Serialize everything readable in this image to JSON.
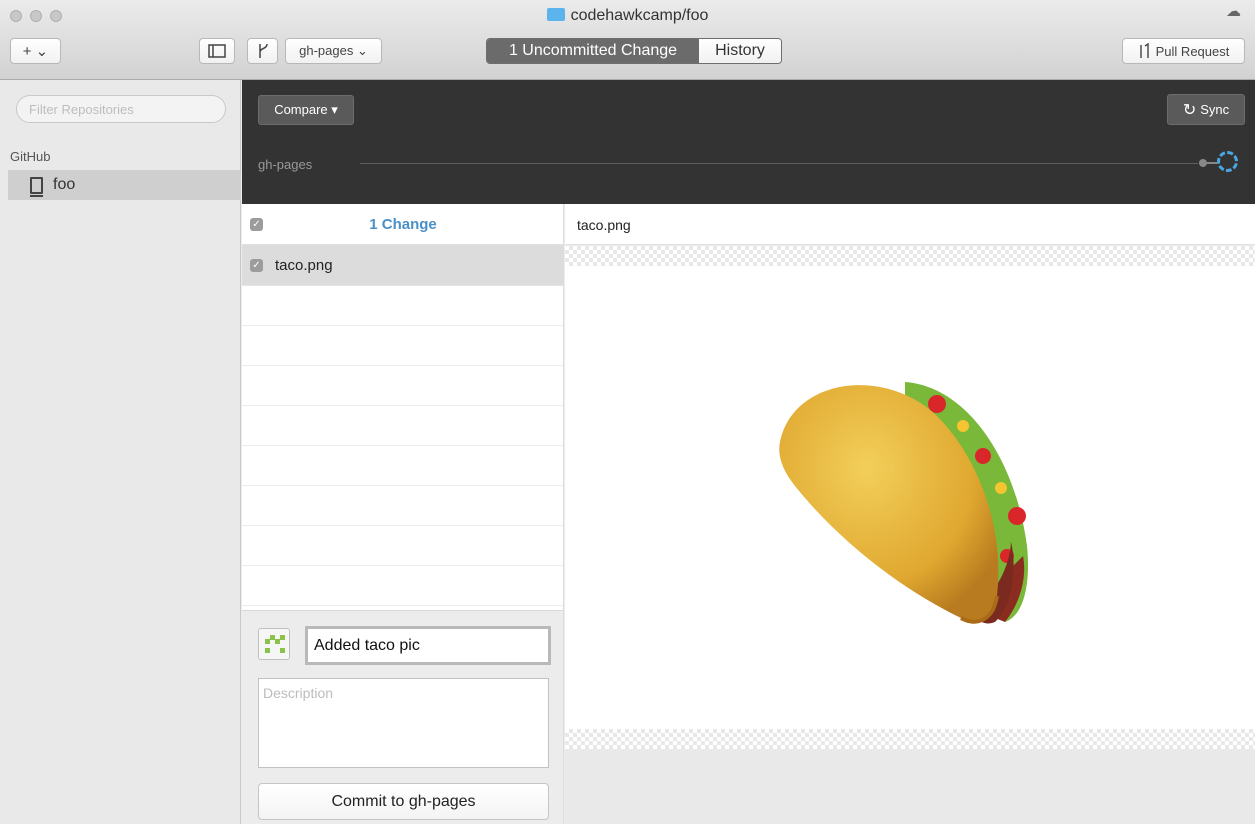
{
  "window": {
    "title": "codehawkcamp/foo"
  },
  "toolbar": {
    "add_label": "+ ⌄",
    "branch_select": "gh-pages ⌄",
    "tab_changes": "1 Uncommitted Change",
    "tab_history": "History",
    "pull_request_label": "Pull Request"
  },
  "sidebar": {
    "filter_placeholder": "Filter Repositories",
    "section_label": "GitHub",
    "repos": [
      {
        "label": "foo",
        "icon": "repo-book-icon",
        "selected": true
      }
    ]
  },
  "branch_bar": {
    "compare_label": "Compare ▾",
    "sync_label": "Sync",
    "branch_name": "gh-pages"
  },
  "changes": {
    "header": "1 Change",
    "files": [
      {
        "name": "taco.png",
        "checked": true
      }
    ]
  },
  "commit": {
    "summary_value": "Added taco pic",
    "description_placeholder": "Description",
    "button_label": "Commit to gh-pages"
  },
  "diff": {
    "file_name": "taco.png",
    "image_description_icon": "taco-image"
  },
  "colors": {
    "accent_blue": "#4a90c8",
    "dark_bar": "#333333",
    "selected_row": "#dcdcdc"
  }
}
